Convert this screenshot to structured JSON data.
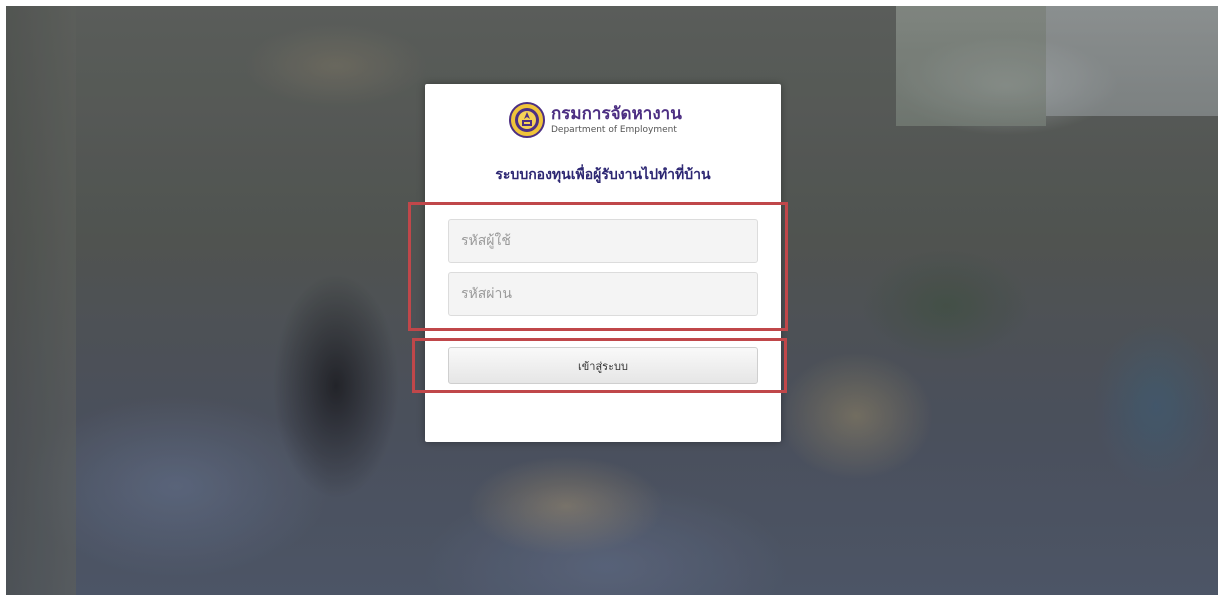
{
  "app": {
    "logo": {
      "name_th": "กรมการจัดหางาน",
      "name_en": "Department of Employment"
    },
    "system_title": "ระบบกองทุนเพื่อผู้รับงานไปทำที่บ้าน"
  },
  "login_form": {
    "username": {
      "placeholder": "รหัสผู้ใช้",
      "value": ""
    },
    "password": {
      "placeholder": "รหัสผ่าน",
      "value": ""
    },
    "submit_label": "เข้าสู่ระบบ"
  },
  "colors": {
    "brand_purple": "#4d2f83",
    "title_navy": "#2d2773",
    "highlight_red": "#c0474a",
    "seal_gold": "#f0c43a"
  },
  "icons": {
    "logo_icon": "department-seal-icon"
  }
}
